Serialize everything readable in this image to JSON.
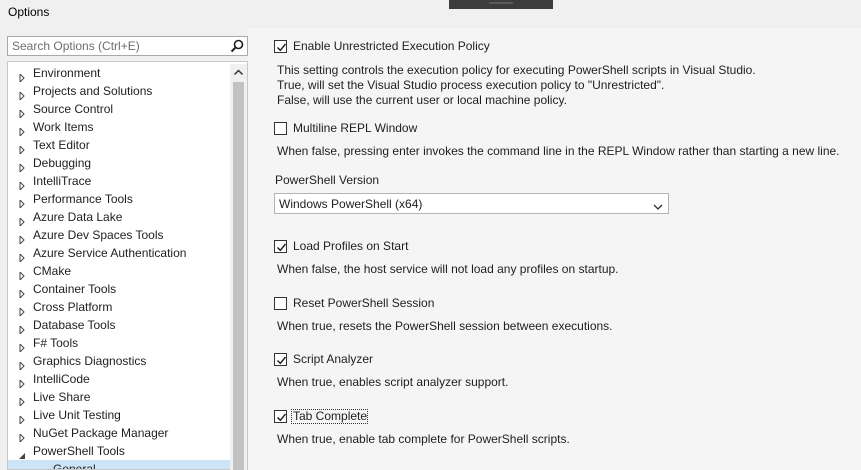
{
  "window": {
    "title": "Options"
  },
  "search": {
    "placeholder": "Search Options (Ctrl+E)"
  },
  "tree": {
    "items": [
      {
        "label": "Environment",
        "state": "collapsed"
      },
      {
        "label": "Projects and Solutions",
        "state": "collapsed"
      },
      {
        "label": "Source Control",
        "state": "collapsed"
      },
      {
        "label": "Work Items",
        "state": "collapsed"
      },
      {
        "label": "Text Editor",
        "state": "collapsed"
      },
      {
        "label": "Debugging",
        "state": "collapsed"
      },
      {
        "label": "IntelliTrace",
        "state": "collapsed"
      },
      {
        "label": "Performance Tools",
        "state": "collapsed"
      },
      {
        "label": "Azure Data Lake",
        "state": "collapsed"
      },
      {
        "label": "Azure Dev Spaces Tools",
        "state": "collapsed"
      },
      {
        "label": "Azure Service Authentication",
        "state": "collapsed"
      },
      {
        "label": "CMake",
        "state": "collapsed"
      },
      {
        "label": "Container Tools",
        "state": "collapsed"
      },
      {
        "label": "Cross Platform",
        "state": "collapsed"
      },
      {
        "label": "Database Tools",
        "state": "collapsed"
      },
      {
        "label": "F# Tools",
        "state": "collapsed"
      },
      {
        "label": "Graphics Diagnostics",
        "state": "collapsed"
      },
      {
        "label": "IntelliCode",
        "state": "collapsed"
      },
      {
        "label": "Live Share",
        "state": "collapsed"
      },
      {
        "label": "Live Unit Testing",
        "state": "collapsed"
      },
      {
        "label": "NuGet Package Manager",
        "state": "collapsed"
      },
      {
        "label": "PowerShell Tools",
        "state": "expanded"
      },
      {
        "label": "General",
        "state": "child-selected"
      }
    ]
  },
  "options": {
    "unrestricted": {
      "label": "Enable Unrestricted Execution Policy",
      "checked": true,
      "desc1": "This setting controls the execution policy for executing PowerShell scripts in Visual Studio.",
      "desc2": "True, will set the Visual Studio process execution policy to \"Unrestricted\".",
      "desc3": "False, will use the current user or local machine policy."
    },
    "multiline": {
      "label": "Multiline REPL Window",
      "checked": false,
      "desc": "When false, pressing enter invokes the command line in the REPL Window rather than starting a new line."
    },
    "version": {
      "label": "PowerShell Version",
      "selected": "Windows PowerShell (x64)"
    },
    "profiles": {
      "label": "Load Profiles on Start",
      "checked": true,
      "desc": "When false, the host service will not load any profiles on startup."
    },
    "reset": {
      "label": "Reset PowerShell Session",
      "checked": false,
      "desc": "When true, resets the PowerShell session between executions."
    },
    "analyzer": {
      "label": "Script Analyzer",
      "checked": true,
      "desc": "When true, enables script analyzer support."
    },
    "tabcomplete": {
      "label": "Tab Complete",
      "checked": true,
      "desc": "When true, enable tab complete for PowerShell scripts."
    }
  }
}
